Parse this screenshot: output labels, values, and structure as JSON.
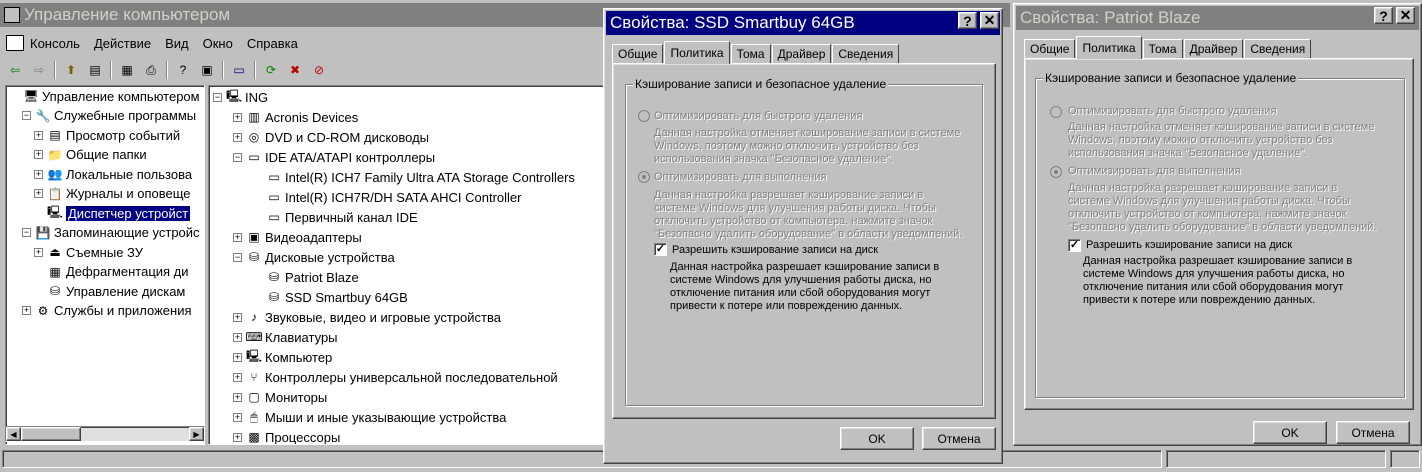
{
  "mmc": {
    "title": "Управление компьютером",
    "menu": [
      "Консоль",
      "Действие",
      "Вид",
      "Окно",
      "Справка"
    ],
    "left_tree": [
      {
        "label": "Управление компьютером",
        "icon": "computer-mgmt-icon",
        "pm": "",
        "indent": 0
      },
      {
        "label": "Служебные программы",
        "icon": "tools-icon",
        "pm": "−",
        "indent": 1
      },
      {
        "label": "Просмотр событий",
        "icon": "event-viewer-icon",
        "pm": "+",
        "indent": 2
      },
      {
        "label": "Общие папки",
        "icon": "shared-folder-icon",
        "pm": "+",
        "indent": 2
      },
      {
        "label": "Локальные пользова",
        "icon": "users-icon",
        "pm": "+",
        "indent": 2
      },
      {
        "label": "Журналы и оповеще",
        "icon": "logs-icon",
        "pm": "+",
        "indent": 2
      },
      {
        "label": "Диспетчер устройст",
        "icon": "device-manager-icon",
        "pm": "",
        "indent": 2,
        "selected": true
      },
      {
        "label": "Запоминающие устройс",
        "icon": "storage-icon",
        "pm": "−",
        "indent": 1
      },
      {
        "label": "Съемные ЗУ",
        "icon": "removable-storage-icon",
        "pm": "+",
        "indent": 2
      },
      {
        "label": "Дефрагментация ди",
        "icon": "defrag-icon",
        "pm": "",
        "indent": 2
      },
      {
        "label": "Управление дискам",
        "icon": "disk-mgmt-icon",
        "pm": "",
        "indent": 2
      },
      {
        "label": "Службы и приложения",
        "icon": "services-icon",
        "pm": "+",
        "indent": 1
      }
    ],
    "right_tree": [
      {
        "label": "ING",
        "pm": "−",
        "indent": 0,
        "icon": "computer-icon"
      },
      {
        "label": "Acronis Devices",
        "pm": "+",
        "indent": 1,
        "icon": "board-icon"
      },
      {
        "label": "DVD и CD-ROM дисководы",
        "pm": "+",
        "indent": 1,
        "icon": "cdrom-icon"
      },
      {
        "label": "IDE ATA/ATAPI контроллеры",
        "pm": "−",
        "indent": 1,
        "icon": "ide-icon"
      },
      {
        "label": "Intel(R) ICH7 Family Ultra ATA Storage Controllers",
        "pm": "",
        "indent": 2,
        "icon": "ide-icon"
      },
      {
        "label": "Intel(R) ICH7R/DH SATA AHCI Controller",
        "pm": "",
        "indent": 2,
        "icon": "ide-icon"
      },
      {
        "label": "Первичный канал IDE",
        "pm": "",
        "indent": 2,
        "icon": "ide-icon"
      },
      {
        "label": "Видеоадаптеры",
        "pm": "+",
        "indent": 1,
        "icon": "display-adapter-icon"
      },
      {
        "label": "Дисковые устройства",
        "pm": "−",
        "indent": 1,
        "icon": "disk-icon"
      },
      {
        "label": "Patriot Blaze",
        "pm": "",
        "indent": 2,
        "icon": "disk-icon"
      },
      {
        "label": "SSD Smartbuy 64GB",
        "pm": "",
        "indent": 2,
        "icon": "disk-icon"
      },
      {
        "label": "Звуковые, видео и игровые устройства",
        "pm": "+",
        "indent": 1,
        "icon": "sound-icon"
      },
      {
        "label": "Клавиатуры",
        "pm": "+",
        "indent": 1,
        "icon": "keyboard-icon"
      },
      {
        "label": "Компьютер",
        "pm": "+",
        "indent": 1,
        "icon": "computer-icon"
      },
      {
        "label": "Контроллеры универсальной последовательной",
        "pm": "+",
        "indent": 1,
        "icon": "usb-icon"
      },
      {
        "label": "Мониторы",
        "pm": "+",
        "indent": 1,
        "icon": "monitor-icon"
      },
      {
        "label": "Мыши и иные указывающие устройства",
        "pm": "+",
        "indent": 1,
        "icon": "mouse-icon"
      },
      {
        "label": "Процессоры",
        "pm": "+",
        "indent": 1,
        "icon": "cpu-icon"
      }
    ]
  },
  "dialog1": {
    "title": "Свойства: SSD Smartbuy 64GB",
    "tabs": [
      "Общие",
      "Политика",
      "Тома",
      "Драйвер",
      "Сведения"
    ],
    "selected_tab": "Политика",
    "group_title": "Кэширование записи и безопасное удаление",
    "opt1_label": "Оптимизировать для быстрого удаления",
    "opt1_desc": [
      "Данная настройка отменяет кэширование записи в системе",
      "Windows, поэтому можно отключить устройство без",
      "использования значка \"Безопасное удаление\"."
    ],
    "opt2_label": "Оптимизировать для выполнения",
    "opt2_desc": [
      "Данная настройка разрешает кэширование записи в",
      "системе Windows для улучшения работы диска. Чтобы",
      "отключить устройство от компьютера, нажмите значок",
      "\"Безопасно удалить оборудование\" в области уведомлений."
    ],
    "check_label": "Разрешить кэширование записи на диск",
    "check_state": "✓",
    "check_desc": [
      "Данная настройка разрешает кэширование записи в",
      "системе Windows для улучшения работы диска, но",
      "отключение питания или сбой оборудования могут",
      "привести к потере или повреждению данных."
    ],
    "ok": "OK",
    "cancel": "Отмена",
    "help": "?",
    "close": "✕"
  },
  "dialog2": {
    "title": "Свойства: Patriot Blaze",
    "tabs": [
      "Общие",
      "Политика",
      "Тома",
      "Драйвер",
      "Сведения"
    ],
    "selected_tab": "Политика",
    "group_title": "Кэширование записи и безопасное удаление",
    "opt1_label": "Оптимизировать для быстрого удаления",
    "opt1_desc": [
      "Данная настройка отменяет кэширование записи в системе",
      "Windows, поэтому можно отключить устройство без",
      "использования значка \"Безопасное удаление\"."
    ],
    "opt2_label": "Оптимизировать для выполнения",
    "opt2_desc": [
      "Данная настройка разрешает кэширование записи в",
      "системе Windows для улучшения работы диска. Чтобы",
      "отключить устройство от компьютера, нажмите значок",
      "\"Безопасно удалить оборудование\" в области уведомлений."
    ],
    "check_label": "Разрешить кэширование записи на диск",
    "check_state": "✓",
    "check_desc": [
      "Данная настройка разрешает кэширование записи в",
      "системе Windows для улучшения работы диска, но",
      "отключение питания или сбой оборудования могут",
      "привести к потере или повреждению данных."
    ],
    "ok": "OK",
    "cancel": "Отмена",
    "help": "?",
    "close": "✕"
  },
  "icons": {
    "back": "⇦",
    "forward": "⇨",
    "up": "⬆",
    "show-tree": "▤",
    "properties": "▦",
    "print": "⎙",
    "help": "?",
    "console": "▣",
    "scan": "⟳",
    "uninstall": "✖",
    "disable": "⊘",
    "window": "▭"
  }
}
